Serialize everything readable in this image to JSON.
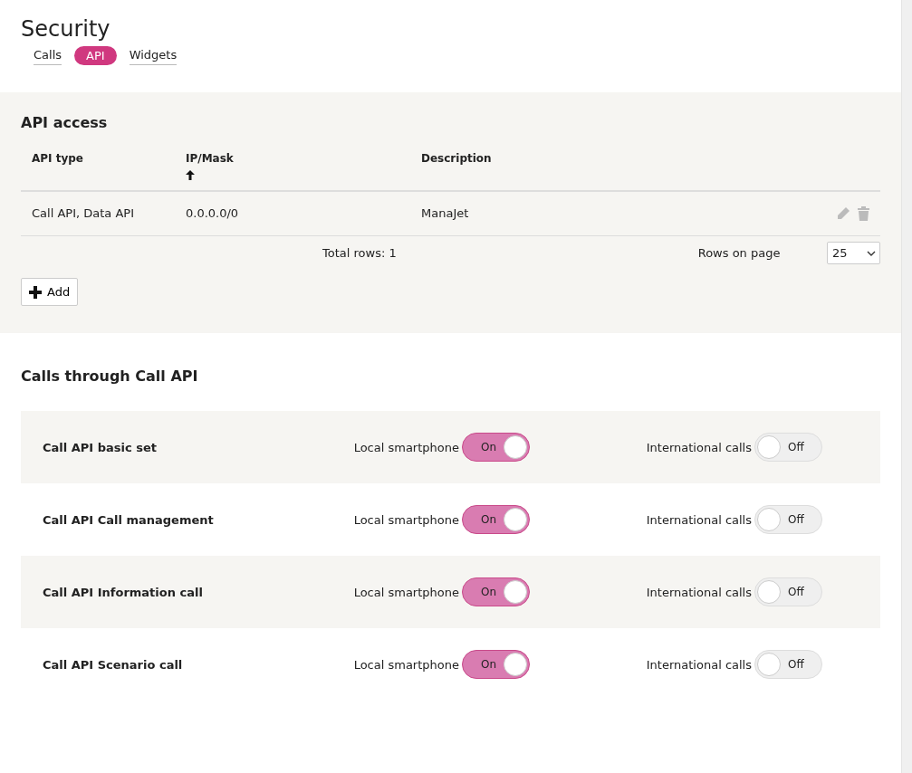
{
  "page": {
    "title": "Security"
  },
  "tabs": [
    {
      "label": "Calls",
      "selected": false
    },
    {
      "label": "API",
      "selected": true
    },
    {
      "label": "Widgets",
      "selected": false
    }
  ],
  "api_access": {
    "title": "API access",
    "columns": [
      {
        "label": "API type",
        "sorted": false
      },
      {
        "label": "IP/Mask",
        "sorted": true
      },
      {
        "label": "Description",
        "sorted": false
      }
    ],
    "rows": [
      {
        "cells": [
          "Call API, Data API",
          "0.0.0.0/0",
          "ManaJet"
        ]
      }
    ],
    "total_rows": "Total rows: 1",
    "rows_on_page_label": "Rows on page",
    "rows_on_page": "25",
    "add_button": "Add"
  },
  "call_api": {
    "title": "Calls through Call API",
    "rows": [
      {
        "name": "Call API basic set",
        "local_label": "Local smartphone",
        "local": {
          "on": true,
          "text": "On"
        },
        "intl_label": "International calls",
        "intl": {
          "on": false,
          "text": "Off"
        }
      },
      {
        "name": "Call API Call management",
        "local_label": "Local smartphone",
        "local": {
          "on": true,
          "text": "On"
        },
        "intl_label": "International calls",
        "intl": {
          "on": false,
          "text": "Off"
        }
      },
      {
        "name": "Call API Information call",
        "local_label": "Local smartphone",
        "local": {
          "on": true,
          "text": "On"
        },
        "intl_label": "International calls",
        "intl": {
          "on": false,
          "text": "Off"
        }
      },
      {
        "name": "Call API Scenario call",
        "local_label": "Local smartphone",
        "local": {
          "on": true,
          "text": "On"
        },
        "intl_label": "International calls",
        "intl": {
          "on": false,
          "text": "Off"
        }
      }
    ]
  }
}
